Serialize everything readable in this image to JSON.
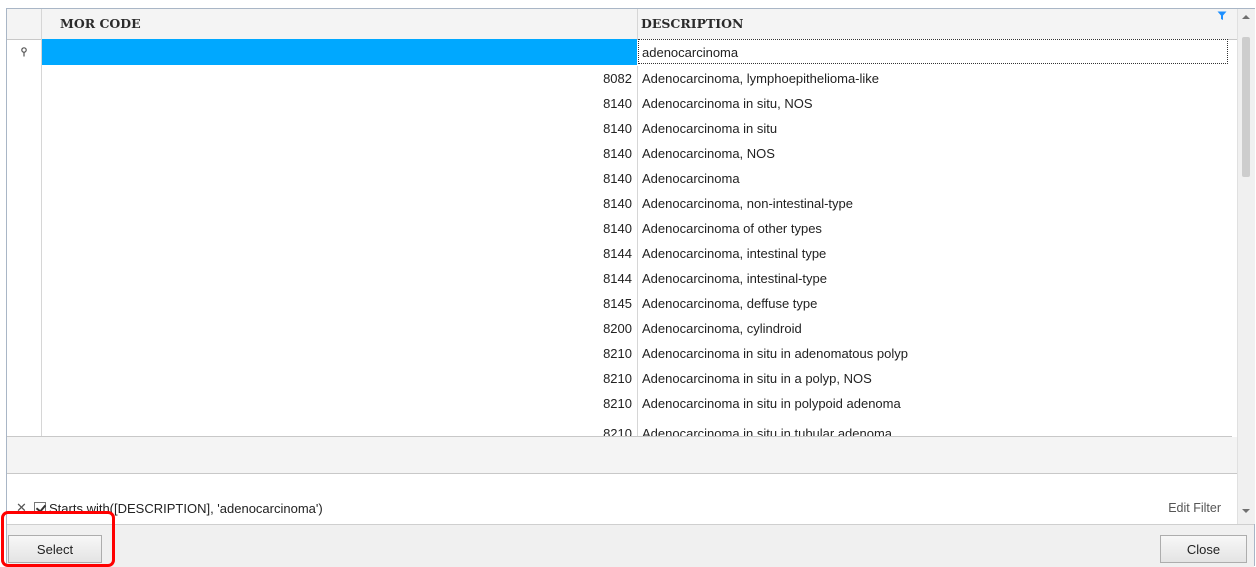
{
  "grid": {
    "columns": [
      "MOR CODE",
      "DESCRIPTION"
    ],
    "filter_row": {
      "mor_code": "",
      "description": "adenocarcinoma"
    },
    "rows": [
      {
        "code": "8082",
        "description": "Adenocarcinoma, lymphoepithelioma-like"
      },
      {
        "code": "8140",
        "description": "Adenocarcinoma in situ, NOS"
      },
      {
        "code": "8140",
        "description": "Adenocarcinoma in situ"
      },
      {
        "code": "8140",
        "description": "Adenocarcinoma, NOS"
      },
      {
        "code": "8140",
        "description": "Adenocarcinoma"
      },
      {
        "code": "8140",
        "description": "Adenocarcinoma, non-intestinal-type"
      },
      {
        "code": "8140",
        "description": "Adenocarcinoma of other types"
      },
      {
        "code": "8144",
        "description": "Adenocarcinoma, intestinal type"
      },
      {
        "code": "8144",
        "description": "Adenocarcinoma, intestinal-type"
      },
      {
        "code": "8145",
        "description": "Adenocarcinoma, deffuse type"
      },
      {
        "code": "8200",
        "description": "Adenocarcinoma, cylindroid"
      },
      {
        "code": "8210",
        "description": "Adenocarcinoma in situ in adenomatous polyp"
      },
      {
        "code": "8210",
        "description": "Adenocarcinoma in situ in a polyp, NOS"
      },
      {
        "code": "8210",
        "description": "Adenocarcinoma in situ in polypoid adenoma"
      },
      {
        "code": "8210",
        "description": "Adenocarcinoma in situ in tubular adenoma"
      }
    ]
  },
  "filter_bar": {
    "expression": "Starts with([DESCRIPTION], 'adenocarcinoma')",
    "edit_label": "Edit Filter",
    "enabled": true
  },
  "footer": {
    "select_label": "Select",
    "close_label": "Close"
  },
  "icons": {
    "filter": "filter-icon",
    "pin": "pin-icon",
    "clear": "close-icon"
  },
  "colors": {
    "selected_cell": "#00a8ff",
    "highlight": "#ff0000",
    "filter_icon": "#1e90ff"
  }
}
